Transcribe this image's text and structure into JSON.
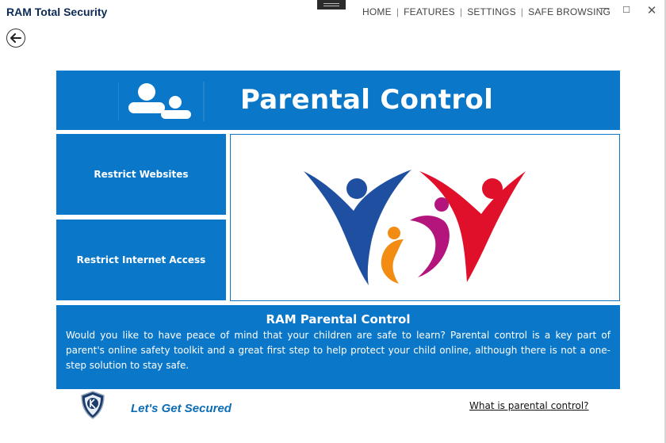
{
  "app": {
    "title": "RAM Total Security"
  },
  "topnav": {
    "items": [
      "HOME",
      "FEATURES",
      "SETTINGS",
      "SAFE BROWSING"
    ]
  },
  "window_controls": {
    "minimize": "—",
    "maximize": "☐",
    "close": "✕"
  },
  "banner": {
    "title": "Parental Control",
    "icon": "users-icon"
  },
  "tiles": [
    {
      "label": "Restrict Websites"
    },
    {
      "label": "Restrict Internet Access"
    }
  ],
  "info": {
    "title": "RAM Parental Control",
    "text": "Would you like to have peace of mind that your children are safe to learn? Parental control is a key part of  parent's online safety toolkit and a great first step to help protect your child online, although there is not a one-step solution to stay safe."
  },
  "footer": {
    "tagline": "Let's Get Secured",
    "help_link": "What is parental control?"
  },
  "colors": {
    "accent": "#0b77c9",
    "figure_blue": "#1f4fa0",
    "figure_red": "#e0102b",
    "figure_orange": "#f28c12",
    "figure_magenta": "#b3157d"
  }
}
